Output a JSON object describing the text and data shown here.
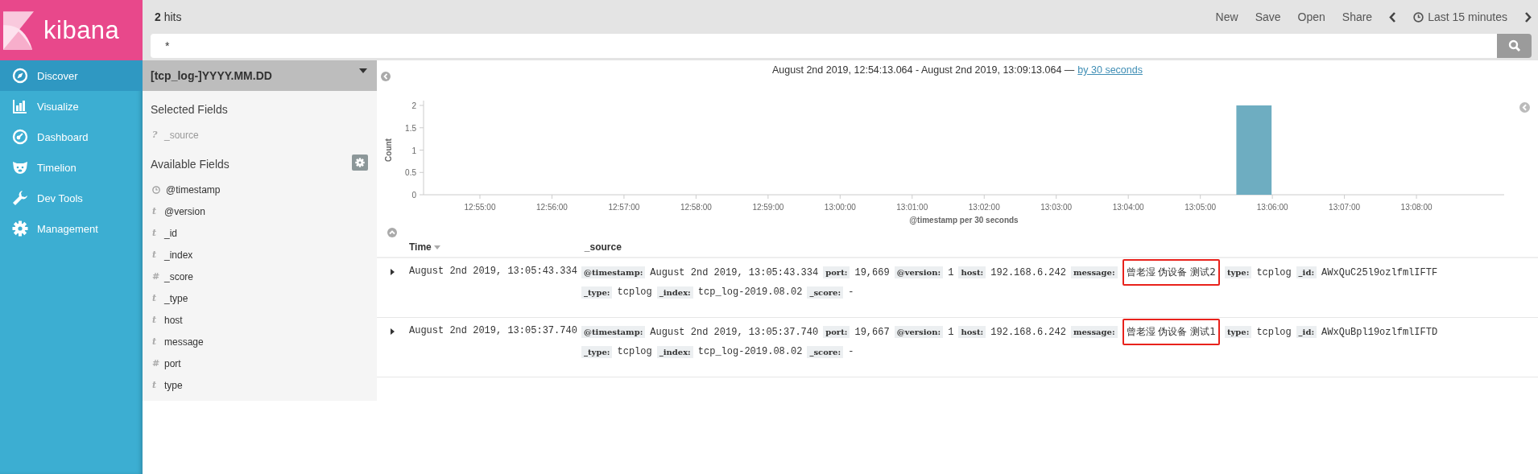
{
  "brand": {
    "name": "kibana"
  },
  "nav": [
    {
      "label": "Discover",
      "kind": "compass",
      "selected": true
    },
    {
      "label": "Visualize",
      "kind": "bars",
      "selected": false
    },
    {
      "label": "Dashboard",
      "kind": "gauge",
      "selected": false
    },
    {
      "label": "Timelion",
      "kind": "bear",
      "selected": false
    },
    {
      "label": "Dev Tools",
      "kind": "wrench",
      "selected": false
    },
    {
      "label": "Management",
      "kind": "gear",
      "selected": false
    }
  ],
  "hits": "**2** hits",
  "menu": [
    "New",
    "Save",
    "Open",
    "Share"
  ],
  "time_range": "Last 15 minutes",
  "query": {
    "value": "*"
  },
  "index_pattern": "[tcp_log-]YYYY.MM.DD",
  "selected_fields": {
    "title": "Selected Fields",
    "items": [
      {
        "kind": "text",
        "glyph": "?",
        "name": "_source",
        "dim": true
      }
    ]
  },
  "available_fields": {
    "title": "Available Fields",
    "items": [
      {
        "kind": "date",
        "name": "@timestamp",
        "dim": false
      },
      {
        "kind": "text",
        "glyph": "t",
        "name": "@version",
        "dim": false
      },
      {
        "kind": "text",
        "glyph": "t",
        "name": "_id",
        "dim": false
      },
      {
        "kind": "text",
        "glyph": "t",
        "name": "_index",
        "dim": false
      },
      {
        "kind": "text",
        "glyph": "#",
        "name": "_score",
        "dim": false
      },
      {
        "kind": "text",
        "glyph": "t",
        "name": "_type",
        "dim": false
      },
      {
        "kind": "text",
        "glyph": "t",
        "name": "host",
        "dim": false
      },
      {
        "kind": "text",
        "glyph": "t",
        "name": "message",
        "dim": false
      },
      {
        "kind": "text",
        "glyph": "#",
        "name": "port",
        "dim": false
      },
      {
        "kind": "text",
        "glyph": "t",
        "name": "type",
        "dim": false
      }
    ]
  },
  "chart": {
    "range": "August 2nd 2019, 12:54:13.064 - August 2nd 2019, 13:09:13.064 —",
    "interval_link": "by 30 seconds",
    "chart_data": {
      "type": "bar",
      "xlabel": "@timestamp per 30 seconds",
      "ylabel": "Count",
      "categories": [
        null,
        null,
        "12:55:00",
        null,
        "12:56:00",
        null,
        "12:57:00",
        null,
        "12:58:00",
        null,
        "12:59:00",
        null,
        "13:00:00",
        null,
        "13:01:00",
        null,
        "13:02:00",
        null,
        "13:03:00",
        null,
        "13:04:00",
        null,
        "13:05:00",
        null,
        "13:06:00",
        null,
        "13:07:00",
        null,
        "13:08:00",
        null,
        null
      ],
      "values": [
        0,
        0,
        0,
        0,
        0,
        0,
        0,
        0,
        0,
        0,
        0,
        0,
        0,
        0,
        0,
        0,
        0,
        0,
        0,
        0,
        0,
        0,
        0,
        2,
        0,
        0,
        0,
        0,
        0,
        0,
        0
      ],
      "ylim": [
        0,
        2
      ],
      "yticks": [
        0,
        0.5,
        1,
        1.5,
        2
      ]
    }
  },
  "table": {
    "columns": [
      "Time",
      "_source"
    ],
    "rows": [
      {
        "time": "August 2nd 2019, 13:05:43.334",
        "source": [
          {
            "key": "@timestamp:",
            "value": "August 2nd 2019, 13:05:43.334",
            "highlighted": false
          },
          {
            "key": "port:",
            "value": "19,669",
            "highlighted": false
          },
          {
            "key": "@version:",
            "value": "1",
            "highlighted": false
          },
          {
            "key": "host:",
            "value": "192.168.6.242",
            "highlighted": false
          },
          {
            "key": "message:",
            "value": "曾老湿 伪设备 测试2",
            "highlighted": true
          },
          {
            "key": "type:",
            "value": "tcplog",
            "highlighted": false
          },
          {
            "key": "_id:",
            "value": "AWxQuC25l9ozlfmlIFTF",
            "highlighted": false
          },
          {
            "key": "_type:",
            "value": "tcplog",
            "highlighted": false
          },
          {
            "key": "_index:",
            "value": "tcp_log-2019.08.02",
            "highlighted": false
          },
          {
            "key": "_score:",
            "value": "-",
            "highlighted": false
          }
        ]
      },
      {
        "time": "August 2nd 2019, 13:05:37.740",
        "source": [
          {
            "key": "@timestamp:",
            "value": "August 2nd 2019, 13:05:37.740",
            "highlighted": false
          },
          {
            "key": "port:",
            "value": "19,667",
            "highlighted": false
          },
          {
            "key": "@version:",
            "value": "1",
            "highlighted": false
          },
          {
            "key": "host:",
            "value": "192.168.6.242",
            "highlighted": false
          },
          {
            "key": "message:",
            "value": "曾老湿 伪设备 测试1",
            "highlighted": true
          },
          {
            "key": "type:",
            "value": "tcplog",
            "highlighted": false
          },
          {
            "key": "_id:",
            "value": "AWxQuBpl19ozlfmlIFTD",
            "highlighted": false
          },
          {
            "key": "_type:",
            "value": "tcplog",
            "highlighted": false
          },
          {
            "key": "_index:",
            "value": "tcp_log-2019.08.02",
            "highlighted": false
          },
          {
            "key": "_score:",
            "value": "-",
            "highlighted": false
          }
        ]
      }
    ]
  }
}
